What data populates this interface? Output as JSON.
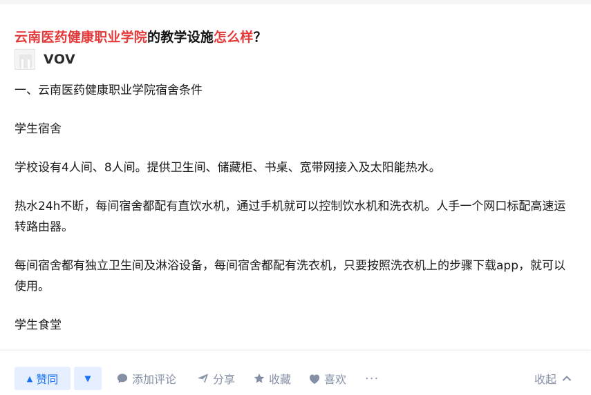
{
  "question": {
    "title_parts": [
      {
        "text": "云南医药健康职业学院",
        "highlight": true
      },
      {
        "text": "的教学设施",
        "highlight": false
      },
      {
        "text": "怎么样",
        "highlight": true
      },
      {
        "text": "？",
        "highlight": false
      }
    ]
  },
  "author": {
    "name": "VOV"
  },
  "content": {
    "paragraphs": [
      "一、云南医药健康职业学院宿舍条件",
      "学生宿舍",
      "学校设有4人间、8人间。提供卫生间、储藏柜、书桌、宽带网接入及太阳能热水。",
      "热水24h不断，每间宿舍都配有直饮水机，通过手机就可以控制饮水机和洗衣机。人手一个网口标配高速运转路由器。",
      "每间宿舍都有独立卫生间及淋浴设备，每间宿舍都配有洗衣机，只要按照洗衣机上的步骤下载app，就可以使用。",
      "学生食堂"
    ]
  },
  "actions": {
    "vote_up_label": "赞同",
    "comment_label": "添加评论",
    "share_label": "分享",
    "favorite_label": "收藏",
    "like_label": "喜欢",
    "more_label": "···",
    "collapse_label": "收起"
  },
  "colors": {
    "highlight": "#e33b3b",
    "accent": "#1772f6",
    "accent_bg": "#e6efff",
    "muted": "#8590a6"
  },
  "icons": {
    "vote_up": "triangle-up-icon",
    "vote_down": "triangle-down-icon",
    "comment": "comment-bubble-icon",
    "share": "paper-plane-icon",
    "favorite": "star-icon",
    "like": "heart-icon",
    "collapse": "chevron-up-icon"
  }
}
